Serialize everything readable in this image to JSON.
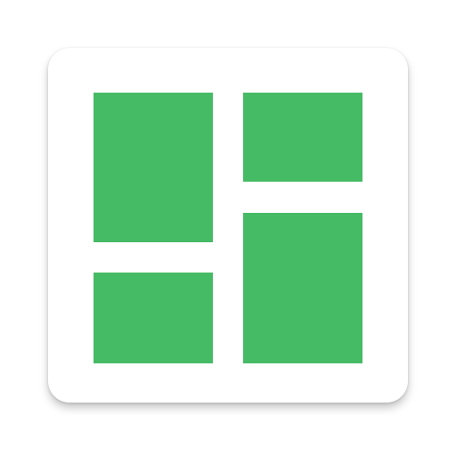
{
  "icon": {
    "name": "grid-layout-icon",
    "background_color": "#ffffff",
    "tile_color": "#46bb65"
  }
}
